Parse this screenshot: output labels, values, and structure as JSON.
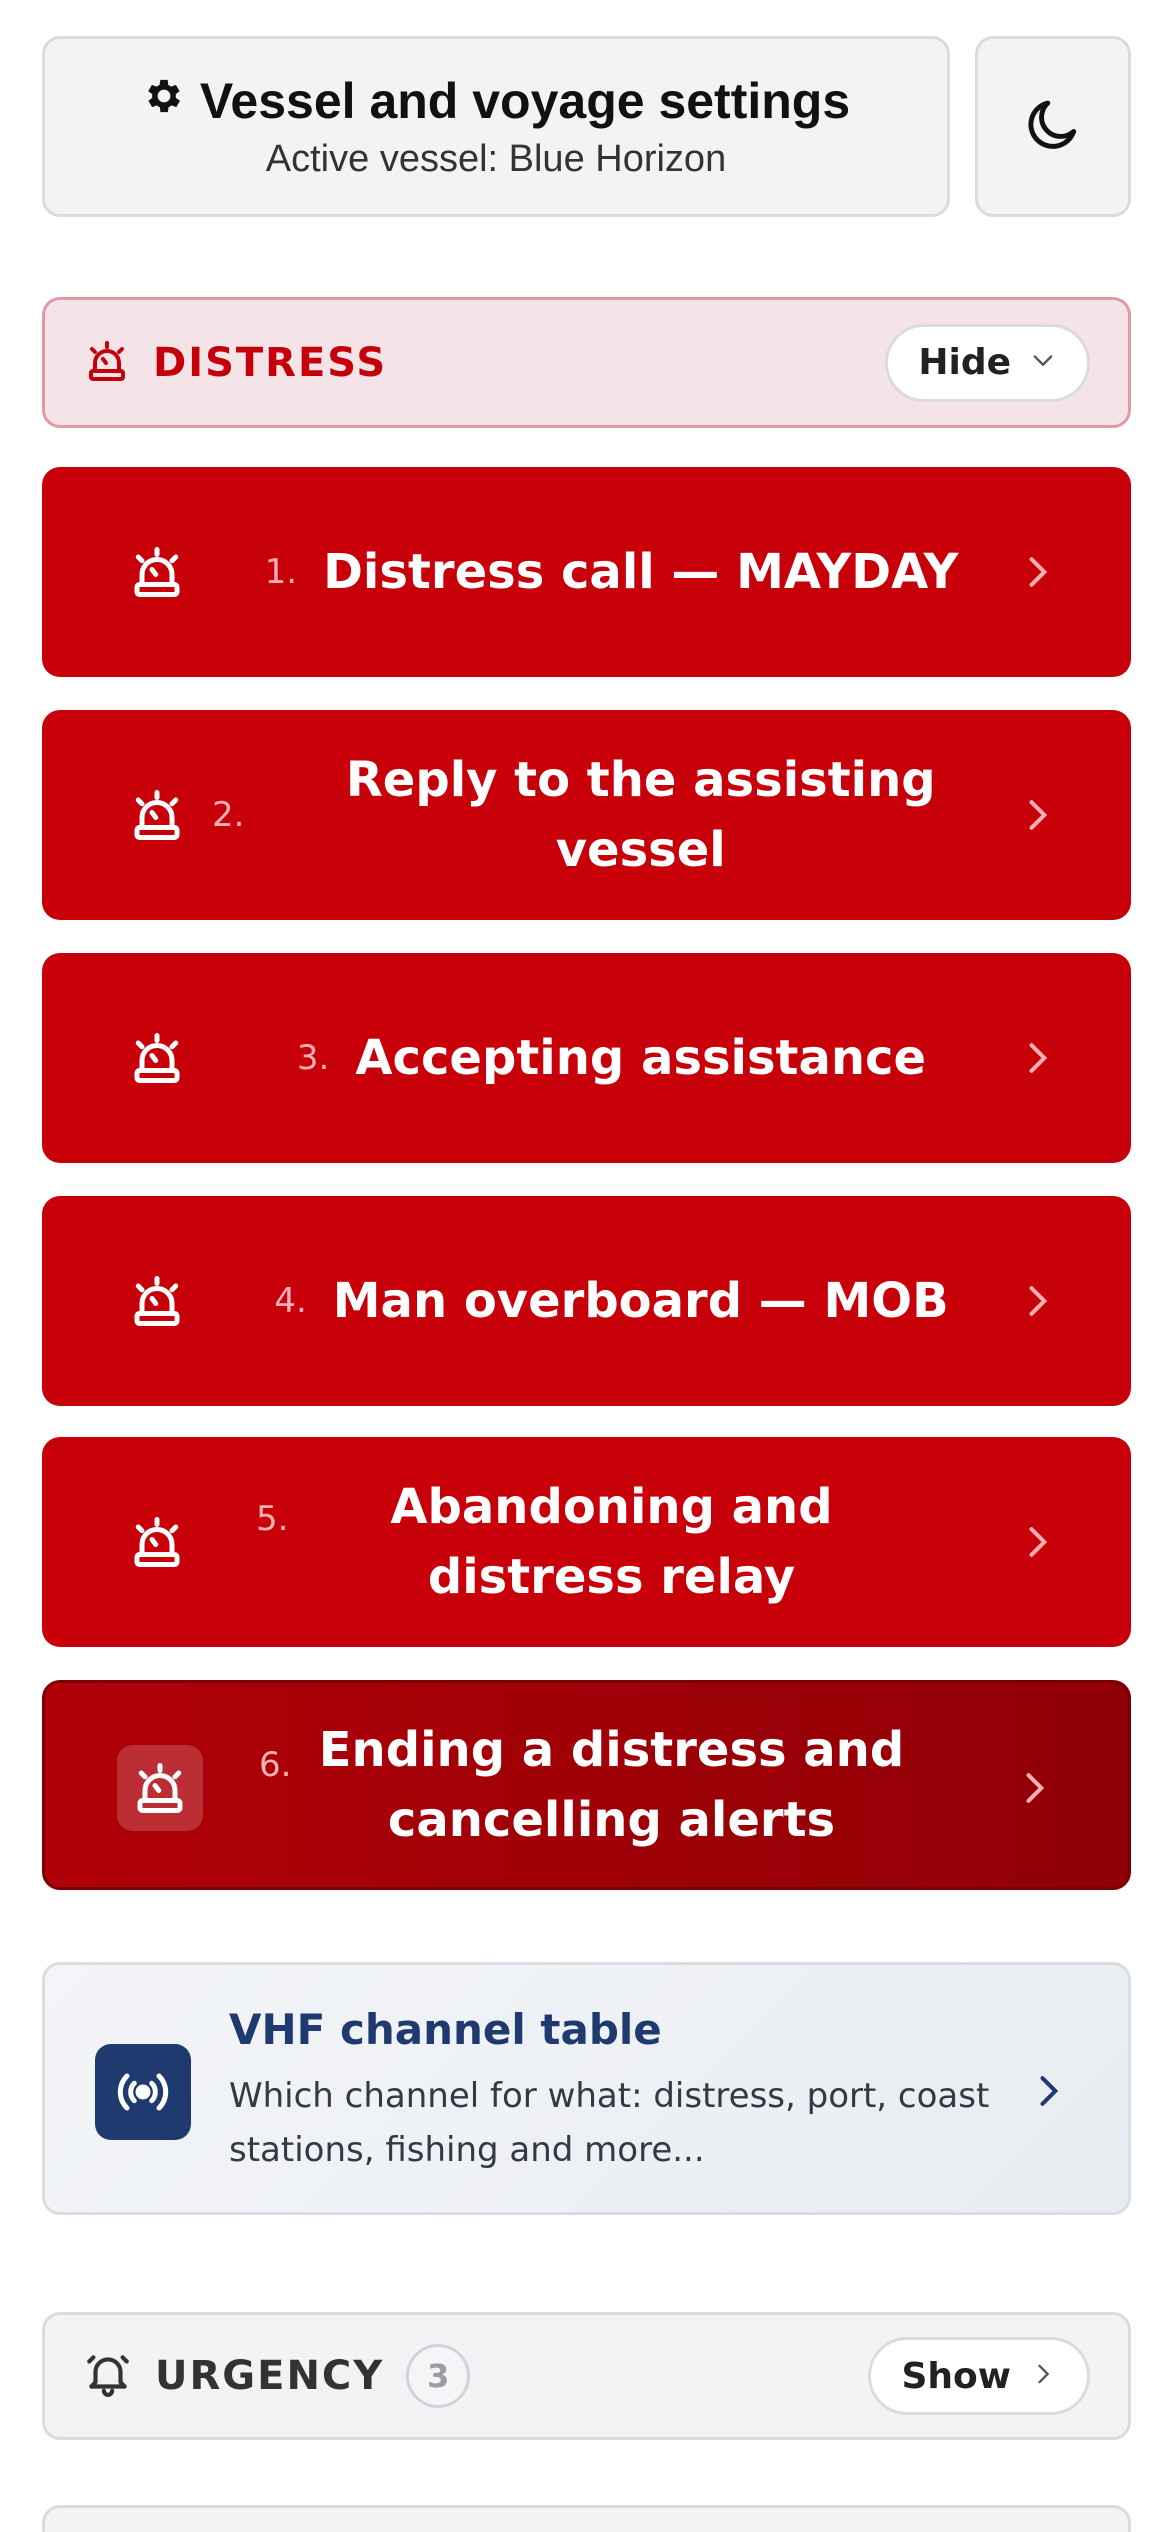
{
  "header": {
    "settings_title": "Vessel and voyage settings",
    "settings_subtitle": "Active vessel: Blue Horizon",
    "theme_icon": "moon-icon"
  },
  "distress": {
    "label": "DISTRESS",
    "toggle_label": "Hide",
    "icon": "siren-icon",
    "accent": "#c8000a",
    "items": [
      {
        "num": "1.",
        "text": "Distress call — MAYDAY"
      },
      {
        "num": "2.",
        "text": "Reply to the assisting vessel"
      },
      {
        "num": "3.",
        "text": "Accepting assistance"
      },
      {
        "num": "4.",
        "text": "Man overboard — MOB"
      },
      {
        "num": "5.",
        "text": "Abandoning and distress relay"
      },
      {
        "num": "6.",
        "text": "Ending a distress and cancelling alerts"
      }
    ]
  },
  "vhf": {
    "title": "VHF channel table",
    "description": "Which channel for what: distress, port, coast stations, fishing and more...",
    "icon": "radio-broadcast-icon",
    "accent": "#1e3a6e"
  },
  "urgency": {
    "label": "URGENCY",
    "count": "3",
    "toggle_label": "Show",
    "icon": "bell-icon"
  }
}
